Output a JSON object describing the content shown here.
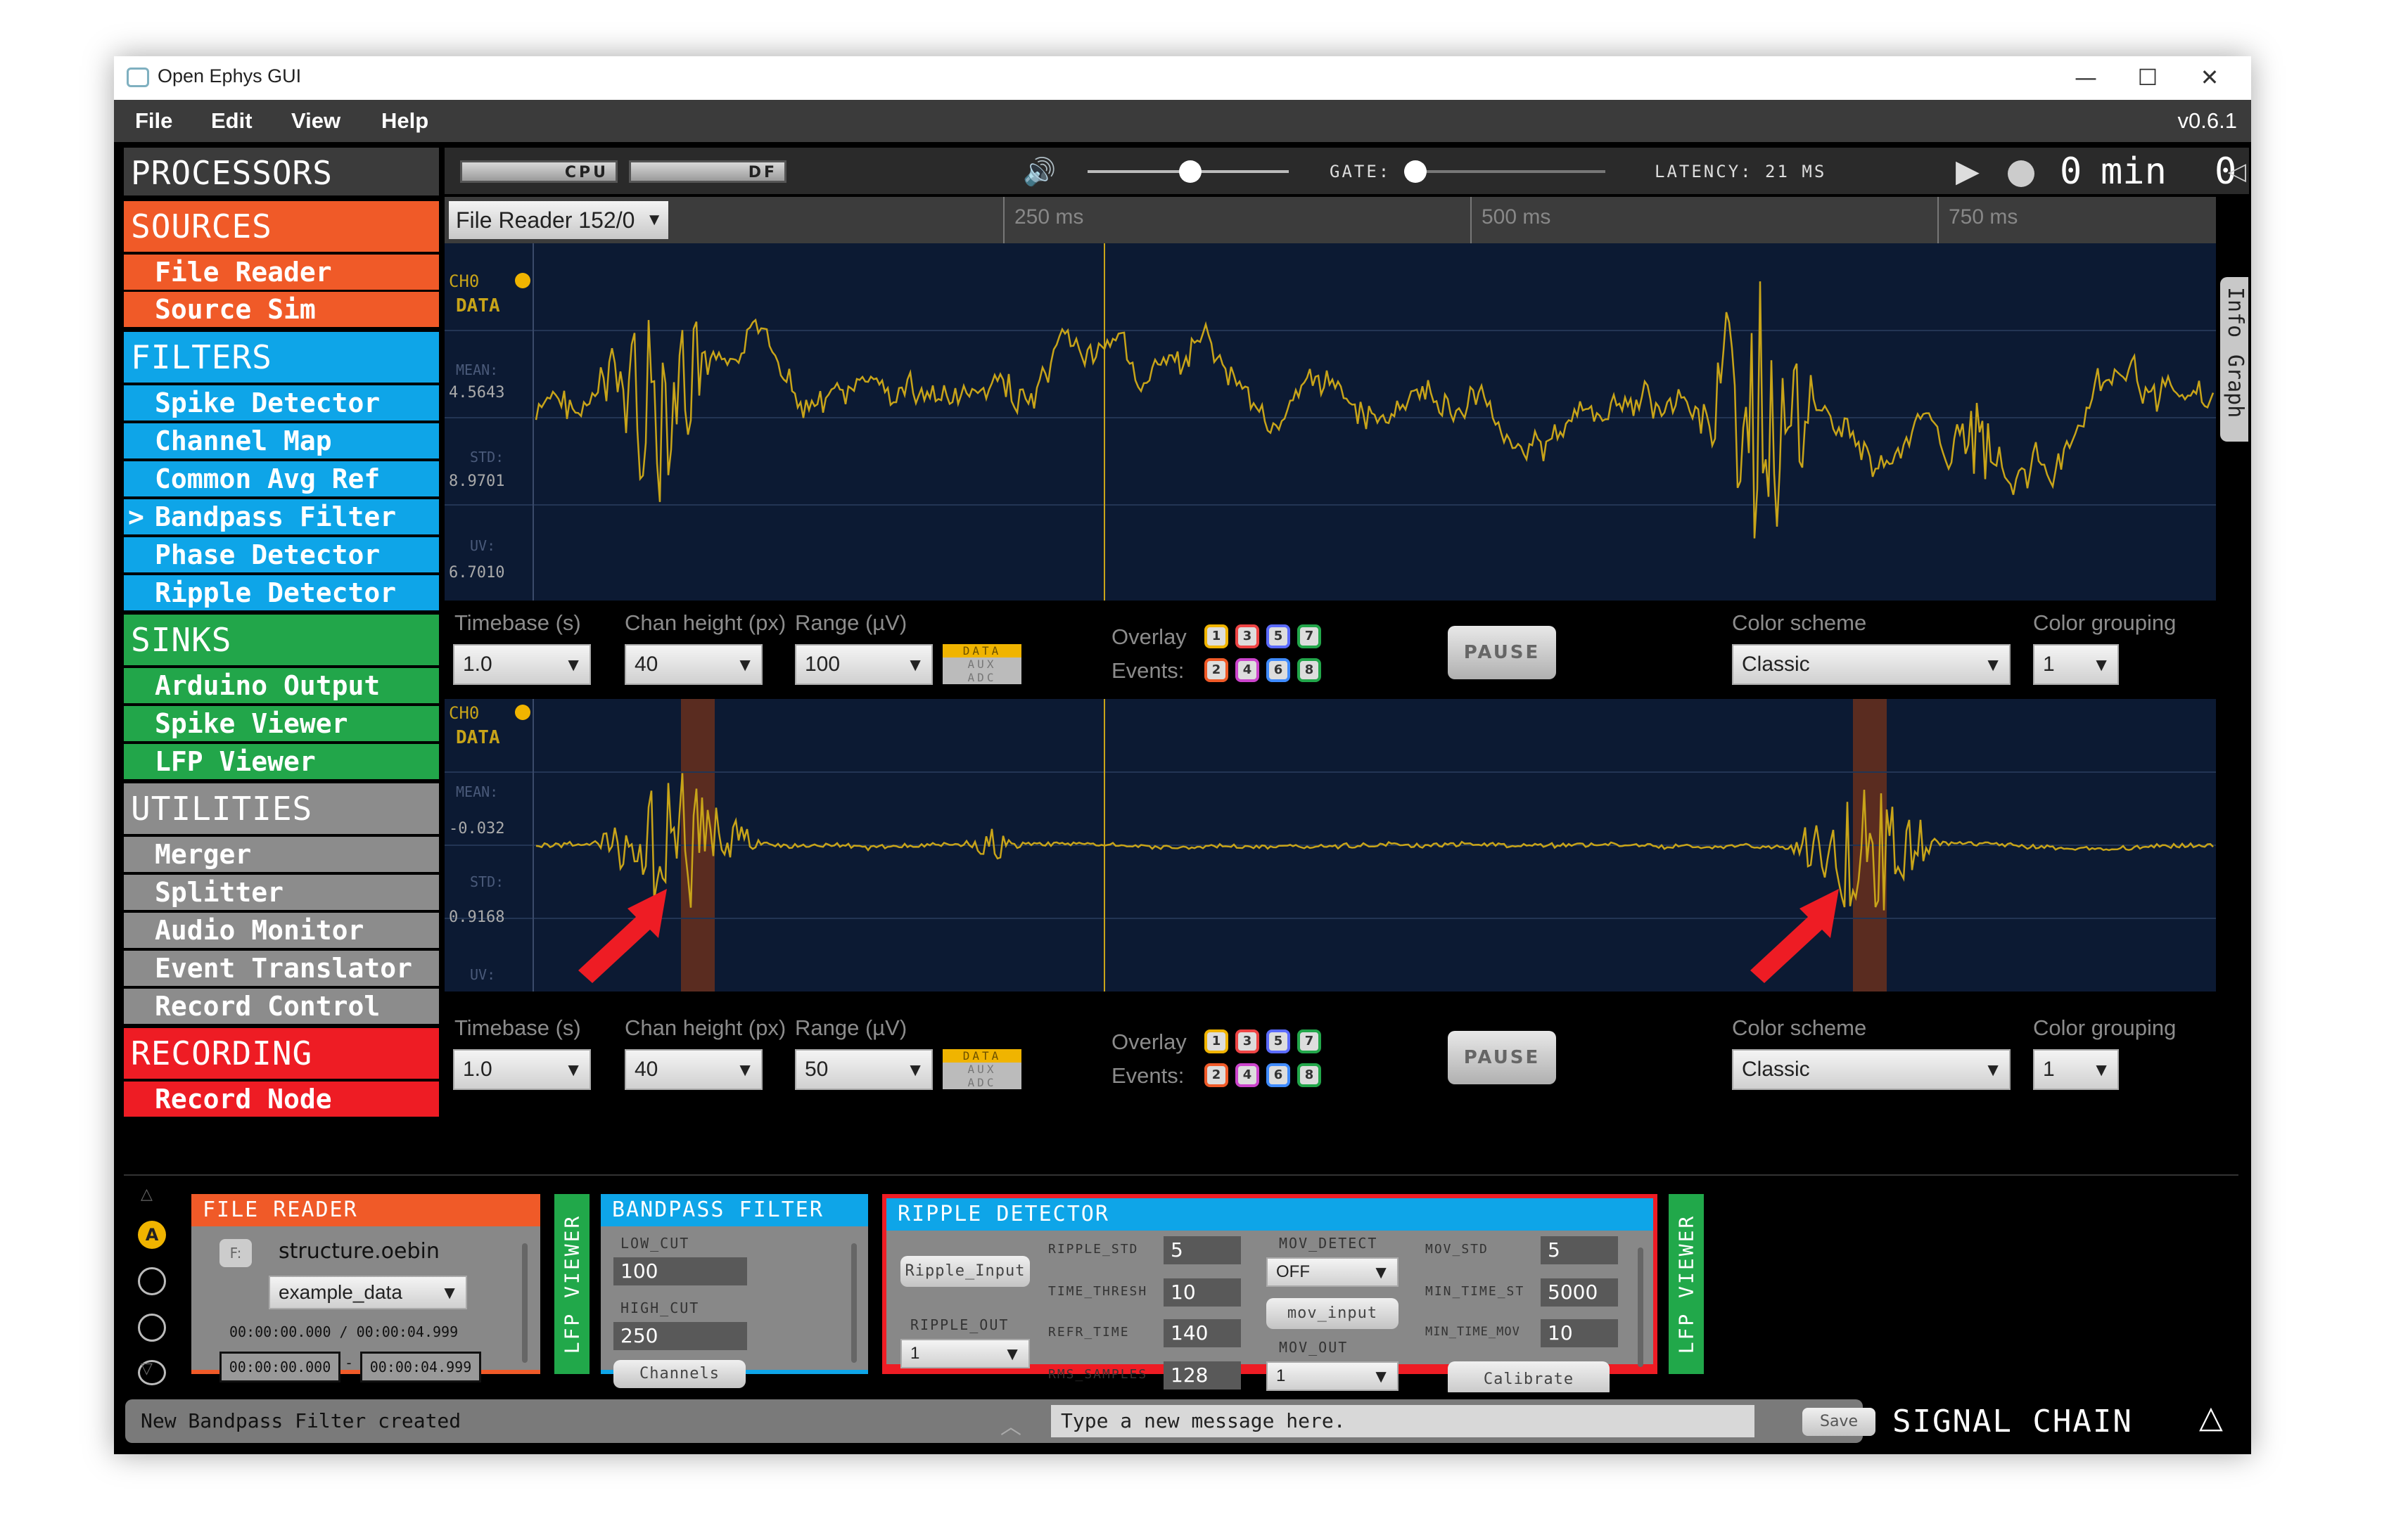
{
  "window": {
    "title": "Open Ephys GUI",
    "version": "v0.6.1"
  },
  "menu": [
    "File",
    "Edit",
    "View",
    "Help"
  ],
  "processors": {
    "title": "PROCESSORS",
    "groups": [
      {
        "name": "SOURCES",
        "color": "#f05a28",
        "items": [
          "File Reader",
          "Source Sim"
        ]
      },
      {
        "name": "FILTERS",
        "color": "#0ea5e8",
        "items": [
          "Spike Detector",
          "Channel Map",
          "Common Avg Ref",
          "Bandpass Filter",
          "Phase Detector",
          "Ripple Detector"
        ]
      },
      {
        "name": "SINKS",
        "color": "#22a64a",
        "items": [
          "Arduino Output",
          "Spike Viewer",
          "LFP Viewer"
        ]
      },
      {
        "name": "UTILITIES",
        "color": "#8c8c8c",
        "items": [
          "Merger",
          "Splitter",
          "Audio Monitor",
          "Event Translator",
          "Record Control"
        ]
      },
      {
        "name": "RECORDING",
        "color": "#ee1c24",
        "items": [
          "Record Node"
        ]
      }
    ],
    "selected_marker": ">"
  },
  "toolbar": {
    "cpu_label": "CPU",
    "df_label": "DF",
    "gate_label": "GATE:",
    "latency_label": "LATENCY: 21 MS",
    "timer": {
      "min_value": "0",
      "min_unit": "min",
      "sec_value": "0",
      "sec_unit": "s"
    },
    "volume_level": 0.5,
    "gate_level": 0.0
  },
  "lfp": {
    "source_select": "File Reader 152/0",
    "ticks": [
      "250 ms",
      "500 ms",
      "750 ms"
    ],
    "side_tabs": [
      "Info",
      "Graph"
    ],
    "plots": [
      {
        "channel": "CH0",
        "tag": "DATA",
        "mean_label": "MEAN:",
        "mean_value": "4.5643",
        "std_label": "STD:",
        "std_value": "8.9701",
        "uv_label": "UV:",
        "uv_value": "6.7010"
      },
      {
        "channel": "CH0",
        "tag": "DATA",
        "mean_label": "MEAN:",
        "mean_value": "-0.032",
        "std_label": "STD:",
        "std_value": "0.9168",
        "uv_label": "UV:",
        "uv_value": ""
      }
    ],
    "controls": [
      {
        "timebase_label": "Timebase (s)",
        "timebase": "1.0",
        "chan_height_label": "Chan height (px)",
        "chan_height": "40",
        "range_label": "Range (µV)",
        "range": "100",
        "type_buttons": [
          "DATA",
          "AUX",
          "ADC"
        ],
        "overlay_label": "Overlay",
        "events_label": "Events:",
        "events_top": [
          "1",
          "3",
          "5",
          "7"
        ],
        "events_bottom": [
          "2",
          "4",
          "6",
          "8"
        ],
        "pause": "PAUSE",
        "color_scheme_label": "Color scheme",
        "color_scheme": "Classic",
        "color_grouping_label": "Color grouping",
        "color_grouping": "1"
      },
      {
        "timebase_label": "Timebase (s)",
        "timebase": "1.0",
        "chan_height_label": "Chan height (px)",
        "chan_height": "40",
        "range_label": "Range (µV)",
        "range": "50",
        "type_buttons": [
          "DATA",
          "AUX",
          "ADC"
        ],
        "overlay_label": "Overlay",
        "events_label": "Events:",
        "events_top": [
          "1",
          "3",
          "5",
          "7"
        ],
        "events_bottom": [
          "2",
          "4",
          "6",
          "8"
        ],
        "pause": "PAUSE",
        "color_scheme_label": "Color scheme",
        "color_scheme": "Classic",
        "color_grouping_label": "Color grouping",
        "color_grouping": "1"
      }
    ]
  },
  "signal_chain": {
    "slot_label": "A",
    "file_reader": {
      "title": "FILE READER",
      "drive": "F:",
      "filename": "structure.oebin",
      "stream": "example_data",
      "time_range": "00:00:00.000 / 00:00:04.999",
      "start": "00:00:00.000",
      "end": "00:00:04.999"
    },
    "lfp_viewer_label": "LFP VIEWER",
    "bandpass": {
      "title": "BANDPASS FILTER",
      "low_cut_label": "LOW_CUT",
      "low_cut": "100",
      "high_cut_label": "HIGH_CUT",
      "high_cut": "250",
      "channels": "Channels"
    },
    "ripple": {
      "title": "RIPPLE DETECTOR",
      "ripple_input": "Ripple_Input",
      "ripple_out_label": "RIPPLE_OUT",
      "ripple_out": "1",
      "ripple_std_label": "RIPPLE_STD",
      "ripple_std": "5",
      "time_thresh_label": "TIME_THRESH",
      "time_thresh": "10",
      "refr_time_label": "REFR_TIME",
      "refr_time": "140",
      "rms_samples_label": "RMS_SAMPLES",
      "rms_samples": "128",
      "mov_detect_label": "MOV_DETECT",
      "mov_detect": "OFF",
      "mov_input": "mov_input",
      "mov_out_label": "MOV_OUT",
      "mov_out": "1",
      "mov_std_label": "MOV_STD",
      "mov_std": "5",
      "min_time_st_label": "MIN_TIME_ST",
      "min_time_st": "5000",
      "min_time_mov_label": "MIN_TIME_MOV",
      "min_time_mov": "10",
      "calibrate": "Calibrate"
    },
    "second_viewer_label": "LFP VIEWER"
  },
  "status": {
    "message": "New Bandpass Filter created",
    "input_placeholder": "Type a new message here.",
    "save": "Save",
    "signal_chain_label": "SIGNAL CHAIN"
  },
  "colors": {
    "trace": "#c8a419",
    "plot_bg": "#0c1a33",
    "highlight": "#5a2c20",
    "arrow": "#ee1c24"
  }
}
